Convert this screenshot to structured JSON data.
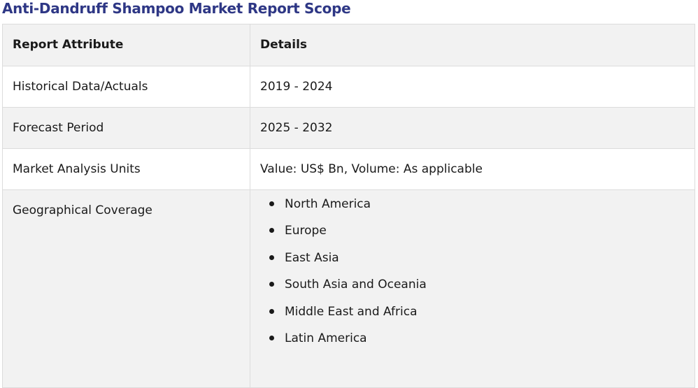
{
  "title": "Anti-Dandruff Shampoo Market Report Scope",
  "table": {
    "headers": [
      "Report Attribute",
      "Details"
    ],
    "rows": [
      {
        "attribute": "Historical Data/Actuals",
        "details": "2019 - 2024"
      },
      {
        "attribute": "Forecast Period",
        "details": "2025 - 2032"
      },
      {
        "attribute": "Market Analysis Units",
        "details": "Value: US$ Bn, Volume: As applicable"
      }
    ],
    "geo": {
      "attribute": "Geographical Coverage",
      "regions": [
        "North America",
        "Europe",
        "East Asia",
        "South Asia and Oceania",
        "Middle East and Africa",
        "Latin America"
      ]
    }
  }
}
